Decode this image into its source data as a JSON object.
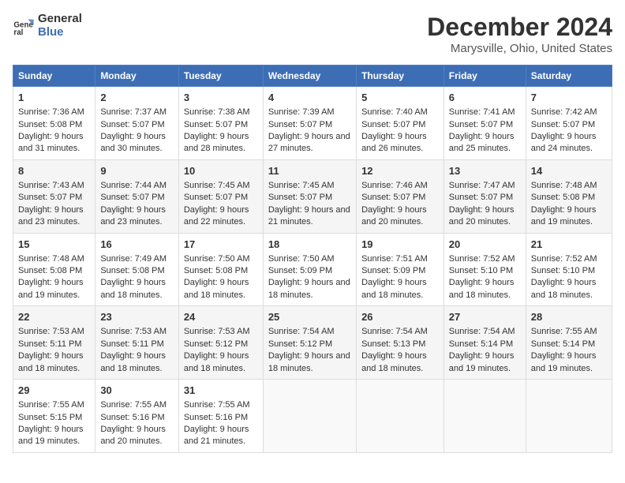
{
  "logo": {
    "line1": "General",
    "line2": "Blue"
  },
  "title": "December 2024",
  "subtitle": "Marysville, Ohio, United States",
  "days_of_week": [
    "Sunday",
    "Monday",
    "Tuesday",
    "Wednesday",
    "Thursday",
    "Friday",
    "Saturday"
  ],
  "weeks": [
    [
      {
        "day": 1,
        "sunrise": "7:36 AM",
        "sunset": "5:08 PM",
        "daylight": "9 hours and 31 minutes."
      },
      {
        "day": 2,
        "sunrise": "7:37 AM",
        "sunset": "5:07 PM",
        "daylight": "9 hours and 30 minutes."
      },
      {
        "day": 3,
        "sunrise": "7:38 AM",
        "sunset": "5:07 PM",
        "daylight": "9 hours and 28 minutes."
      },
      {
        "day": 4,
        "sunrise": "7:39 AM",
        "sunset": "5:07 PM",
        "daylight": "9 hours and 27 minutes."
      },
      {
        "day": 5,
        "sunrise": "7:40 AM",
        "sunset": "5:07 PM",
        "daylight": "9 hours and 26 minutes."
      },
      {
        "day": 6,
        "sunrise": "7:41 AM",
        "sunset": "5:07 PM",
        "daylight": "9 hours and 25 minutes."
      },
      {
        "day": 7,
        "sunrise": "7:42 AM",
        "sunset": "5:07 PM",
        "daylight": "9 hours and 24 minutes."
      }
    ],
    [
      {
        "day": 8,
        "sunrise": "7:43 AM",
        "sunset": "5:07 PM",
        "daylight": "9 hours and 23 minutes."
      },
      {
        "day": 9,
        "sunrise": "7:44 AM",
        "sunset": "5:07 PM",
        "daylight": "9 hours and 23 minutes."
      },
      {
        "day": 10,
        "sunrise": "7:45 AM",
        "sunset": "5:07 PM",
        "daylight": "9 hours and 22 minutes."
      },
      {
        "day": 11,
        "sunrise": "7:45 AM",
        "sunset": "5:07 PM",
        "daylight": "9 hours and 21 minutes."
      },
      {
        "day": 12,
        "sunrise": "7:46 AM",
        "sunset": "5:07 PM",
        "daylight": "9 hours and 20 minutes."
      },
      {
        "day": 13,
        "sunrise": "7:47 AM",
        "sunset": "5:07 PM",
        "daylight": "9 hours and 20 minutes."
      },
      {
        "day": 14,
        "sunrise": "7:48 AM",
        "sunset": "5:08 PM",
        "daylight": "9 hours and 19 minutes."
      }
    ],
    [
      {
        "day": 15,
        "sunrise": "7:48 AM",
        "sunset": "5:08 PM",
        "daylight": "9 hours and 19 minutes."
      },
      {
        "day": 16,
        "sunrise": "7:49 AM",
        "sunset": "5:08 PM",
        "daylight": "9 hours and 18 minutes."
      },
      {
        "day": 17,
        "sunrise": "7:50 AM",
        "sunset": "5:08 PM",
        "daylight": "9 hours and 18 minutes."
      },
      {
        "day": 18,
        "sunrise": "7:50 AM",
        "sunset": "5:09 PM",
        "daylight": "9 hours and 18 minutes."
      },
      {
        "day": 19,
        "sunrise": "7:51 AM",
        "sunset": "5:09 PM",
        "daylight": "9 hours and 18 minutes."
      },
      {
        "day": 20,
        "sunrise": "7:52 AM",
        "sunset": "5:10 PM",
        "daylight": "9 hours and 18 minutes."
      },
      {
        "day": 21,
        "sunrise": "7:52 AM",
        "sunset": "5:10 PM",
        "daylight": "9 hours and 18 minutes."
      }
    ],
    [
      {
        "day": 22,
        "sunrise": "7:53 AM",
        "sunset": "5:11 PM",
        "daylight": "9 hours and 18 minutes."
      },
      {
        "day": 23,
        "sunrise": "7:53 AM",
        "sunset": "5:11 PM",
        "daylight": "9 hours and 18 minutes."
      },
      {
        "day": 24,
        "sunrise": "7:53 AM",
        "sunset": "5:12 PM",
        "daylight": "9 hours and 18 minutes."
      },
      {
        "day": 25,
        "sunrise": "7:54 AM",
        "sunset": "5:12 PM",
        "daylight": "9 hours and 18 minutes."
      },
      {
        "day": 26,
        "sunrise": "7:54 AM",
        "sunset": "5:13 PM",
        "daylight": "9 hours and 18 minutes."
      },
      {
        "day": 27,
        "sunrise": "7:54 AM",
        "sunset": "5:14 PM",
        "daylight": "9 hours and 19 minutes."
      },
      {
        "day": 28,
        "sunrise": "7:55 AM",
        "sunset": "5:14 PM",
        "daylight": "9 hours and 19 minutes."
      }
    ],
    [
      {
        "day": 29,
        "sunrise": "7:55 AM",
        "sunset": "5:15 PM",
        "daylight": "9 hours and 19 minutes."
      },
      {
        "day": 30,
        "sunrise": "7:55 AM",
        "sunset": "5:16 PM",
        "daylight": "9 hours and 20 minutes."
      },
      {
        "day": 31,
        "sunrise": "7:55 AM",
        "sunset": "5:16 PM",
        "daylight": "9 hours and 21 minutes."
      },
      null,
      null,
      null,
      null
    ]
  ],
  "labels": {
    "sunrise": "Sunrise:",
    "sunset": "Sunset:",
    "daylight": "Daylight:"
  }
}
